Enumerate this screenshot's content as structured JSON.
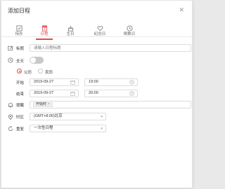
{
  "dialog": {
    "title": "添加日程",
    "close_icon": "close-icon"
  },
  "tabs": [
    {
      "label": "待办",
      "icon": "checkbox-icon"
    },
    {
      "label": "日程",
      "icon": "calendar-doc-icon",
      "active": true
    },
    {
      "label": "生日",
      "icon": "cake-icon"
    },
    {
      "label": "纪念日",
      "icon": "heart-icon"
    },
    {
      "label": "倒数日",
      "icon": "clock-icon"
    }
  ],
  "form": {
    "title_label": "标题",
    "title_placeholder": "请输入日程标题",
    "allday_label": "全天",
    "allday_on": false,
    "calendar_options": [
      "公历",
      "农历"
    ],
    "calendar_selected": "公历",
    "start_label": "开始",
    "start_date": "2019-09-27",
    "start_time": "19:00",
    "end_label": "结束",
    "end_date": "2019-09-27",
    "end_time": "20:00",
    "remind_label": "提醒",
    "remind_tag": "开始时",
    "remind_tag_close": "×",
    "timezone_label": "时区",
    "timezone_value": "(GMT+8:00)北京",
    "repeat_label": "重复",
    "repeat_value": "一次性日程"
  },
  "colors": {
    "accent": "#e04a4a",
    "border": "#dcdcdc",
    "muted": "#999999"
  }
}
